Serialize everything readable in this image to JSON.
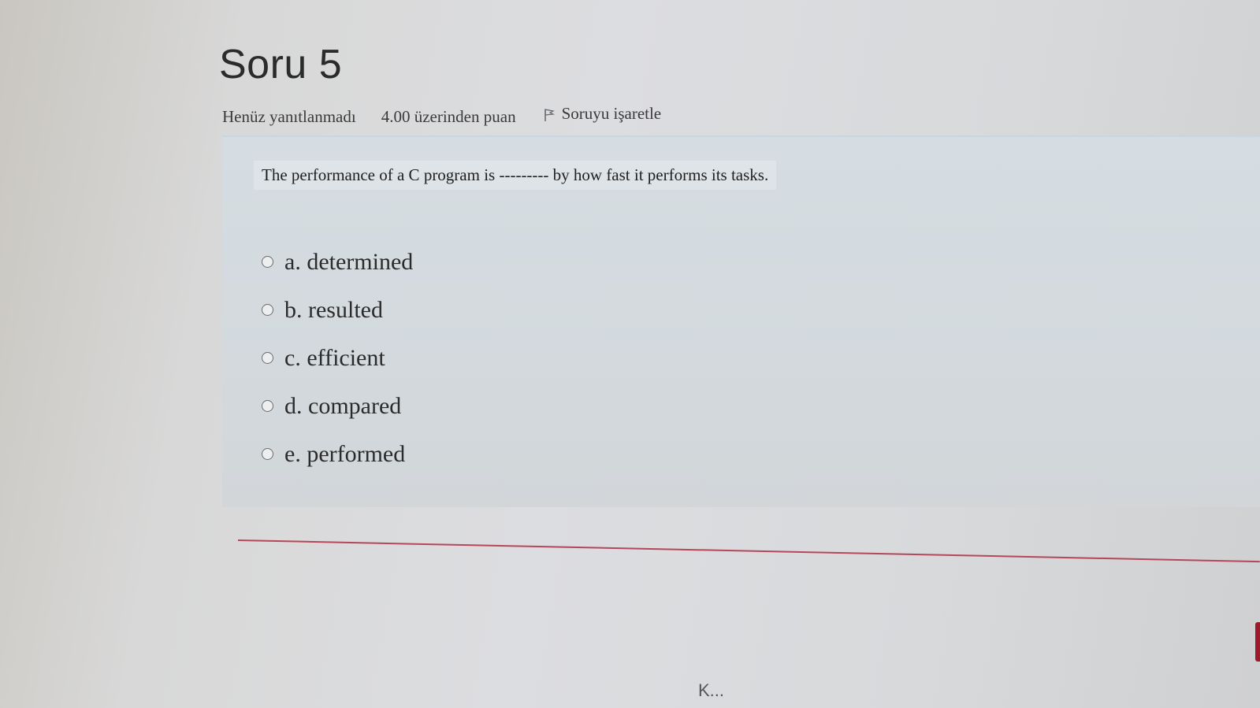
{
  "question": {
    "title": "Soru 5",
    "status": "Henüz yanıtlanmadı",
    "grade": "4.00 üzerinden puan",
    "flag_label": "Soruyu işaretle",
    "flag_icon": "flag-icon",
    "text": "The performance of a C program is --------- by how fast it performs its tasks.",
    "answers": [
      {
        "label": "a. determined"
      },
      {
        "label": "b. resulted"
      },
      {
        "label": "c. efficient"
      },
      {
        "label": "d. compared"
      },
      {
        "label": "e. performed"
      }
    ]
  },
  "footer": {
    "partial_text": "K..."
  },
  "colors": {
    "divider": "#b4485a",
    "panel_bg": "#d5dde2"
  }
}
